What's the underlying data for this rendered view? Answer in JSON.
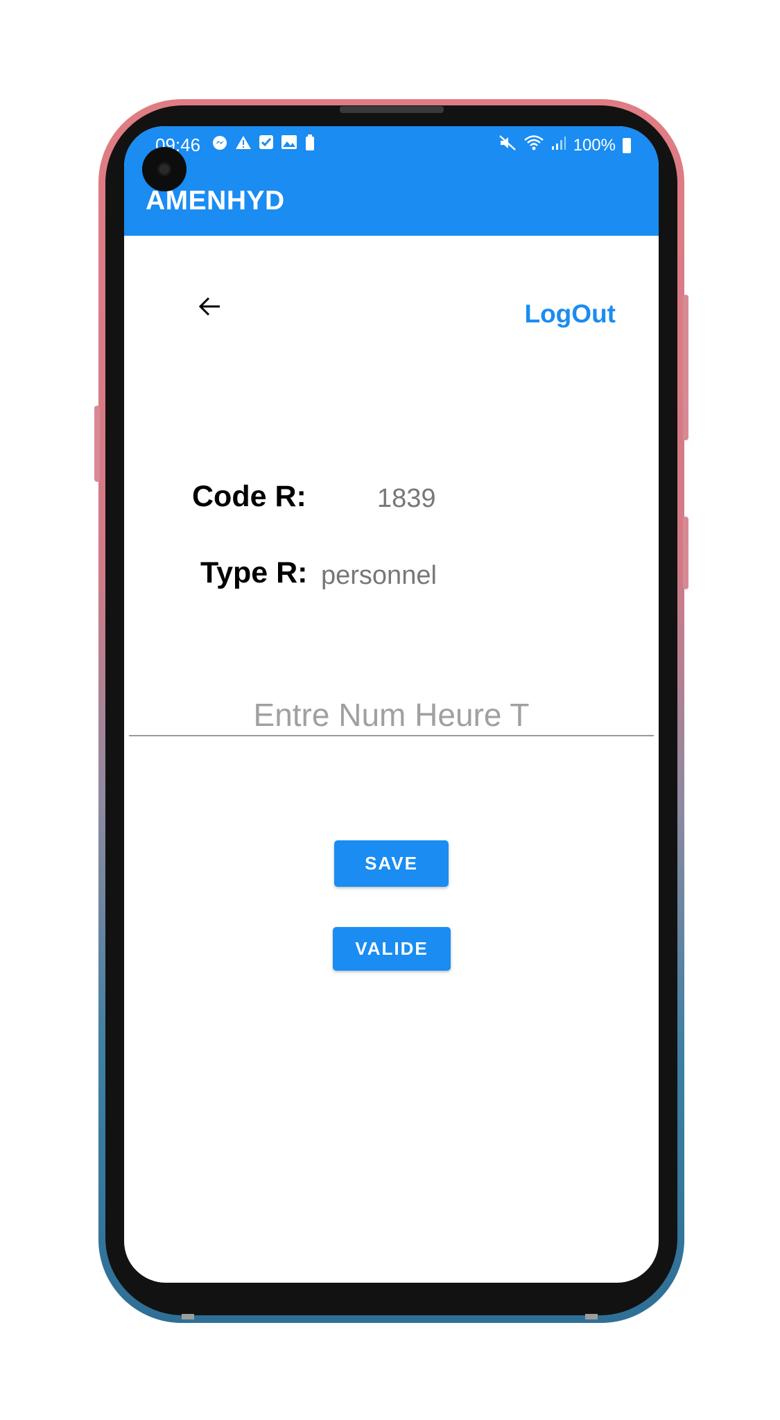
{
  "status_bar": {
    "time": "09:46",
    "left_icons": [
      "messenger-icon",
      "warning-icon",
      "checkbox-icon",
      "image-icon",
      "battery-saver-icon"
    ],
    "battery": "100%"
  },
  "app_bar": {
    "title": "AMENHYD",
    "color": "#1a8cf2"
  },
  "nav": {
    "logout_label": "LogOut"
  },
  "info": {
    "code_label": "Code R:",
    "code_value": "1839",
    "type_label": "Type R:",
    "type_value": "personnel"
  },
  "entry": {
    "placeholder": "Entre Num Heure T",
    "value": ""
  },
  "buttons": {
    "save_label": "SAVE",
    "valide_label": "VALIDE"
  }
}
